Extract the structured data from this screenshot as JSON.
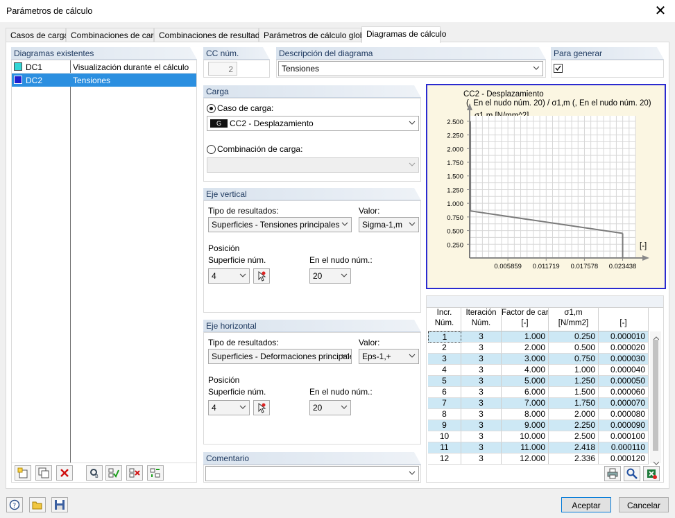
{
  "window": {
    "title": "Parámetros de cálculo",
    "close_glyph": "✕"
  },
  "tabs": [
    {
      "label": "Casos de carga"
    },
    {
      "label": "Combinaciones de carga"
    },
    {
      "label": "Combinaciones de resultados"
    },
    {
      "label": "Parámetros de cálculo global"
    },
    {
      "label": "Diagramas de cálculo",
      "active": true
    }
  ],
  "existing": {
    "header": "Diagramas existentes",
    "items": [
      {
        "id": "DC1",
        "desc": "Visualización durante el cálculo",
        "color": "#33d6d6",
        "selected": false
      },
      {
        "id": "DC2",
        "desc": "Tensiones",
        "color": "#1f1fd0",
        "selected": true
      }
    ]
  },
  "cc": {
    "header": "CC núm.",
    "value": "2"
  },
  "description": {
    "header": "Descripción del diagrama",
    "value": "Tensiones"
  },
  "generate": {
    "header": "Para generar",
    "checked": true
  },
  "carga": {
    "header": "Carga",
    "load_case_label": "Caso de carga:",
    "load_case_value": "CC2 - Desplazamiento",
    "load_case_tag": "G",
    "load_combo_label": "Combinación de carga:"
  },
  "vertical": {
    "header": "Eje vertical",
    "type_label": "Tipo de resultados:",
    "type_value": "Superficies - Tensiones principales",
    "value_label": "Valor:",
    "value_value": "Sigma-1,m",
    "position_label": "Posición",
    "surface_label": "Superficie núm.",
    "surface_value": "4",
    "node_label": "En el nudo núm.:",
    "node_value": "20"
  },
  "horizontal": {
    "header": "Eje horizontal",
    "type_label": "Tipo de resultados:",
    "type_value": "Superficies - Deformaciones principales",
    "value_label": "Valor:",
    "value_value": "Eps-1,+",
    "position_label": "Posición",
    "surface_label": "Superficie núm.",
    "surface_value": "4",
    "node_label": "En el nudo núm.:",
    "node_value": "20"
  },
  "comment": {
    "header": "Comentario",
    "value": ""
  },
  "chart_data": {
    "type": "line",
    "title_line1": "CC2 - Desplazamiento",
    "title_line2": "(, En el nudo núm. 20) / σ1,m (, En el nudo núm. 20)",
    "ylabel": "σ1,m [N/mm^2]",
    "xlabel": "[-]",
    "y_ticks": [
      "2.500",
      "2.250",
      "2.000",
      "1.750",
      "1.500",
      "1.250",
      "1.000",
      "0.750",
      "0.500",
      "0.250"
    ],
    "x_ticks": [
      "0.005859",
      "0.011719",
      "0.017578",
      "0.023438"
    ],
    "ylim": [
      0,
      2.6
    ],
    "xlim": [
      0,
      0.0254
    ],
    "grid": true,
    "series": [
      {
        "x": [
          0.0,
          1e-05,
          2e-05,
          3e-05,
          4e-05,
          5e-05,
          6e-05,
          7e-05,
          8e-05,
          9e-05,
          0.0001,
          0.00011,
          0.00012,
          0.023438
        ],
        "y": [
          0.0,
          0.25,
          0.5,
          0.75,
          1.0,
          1.25,
          1.5,
          1.75,
          2.0,
          2.25,
          2.5,
          2.418,
          0.86,
          0.45
        ]
      }
    ]
  },
  "table": {
    "headers": [
      {
        "l1": "Incr.",
        "l2": "Núm."
      },
      {
        "l1": "Iteración",
        "l2": "Núm."
      },
      {
        "l1": "Factor de car",
        "l2": "[-]"
      },
      {
        "l1": "σ1,m",
        "l2": "[N/mm2]"
      },
      {
        "l1": "",
        "l2": "[-]"
      }
    ],
    "rows": [
      [
        "1",
        "3",
        "1.000",
        "0.250",
        "0.000010"
      ],
      [
        "2",
        "3",
        "2.000",
        "0.500",
        "0.000020"
      ],
      [
        "3",
        "3",
        "3.000",
        "0.750",
        "0.000030"
      ],
      [
        "4",
        "3",
        "4.000",
        "1.000",
        "0.000040"
      ],
      [
        "5",
        "3",
        "5.000",
        "1.250",
        "0.000050"
      ],
      [
        "6",
        "3",
        "6.000",
        "1.500",
        "0.000060"
      ],
      [
        "7",
        "3",
        "7.000",
        "1.750",
        "0.000070"
      ],
      [
        "8",
        "3",
        "8.000",
        "2.000",
        "0.000080"
      ],
      [
        "9",
        "3",
        "9.000",
        "2.250",
        "0.000090"
      ],
      [
        "10",
        "3",
        "10.000",
        "2.500",
        "0.000100"
      ],
      [
        "11",
        "3",
        "11.000",
        "2.418",
        "0.000110"
      ],
      [
        "12",
        "3",
        "12.000",
        "2.336",
        "0.000120"
      ]
    ]
  },
  "footer": {
    "ok_label": "Aceptar",
    "cancel_label": "Cancelar"
  },
  "colors": {
    "accent_row": "#cde8f5",
    "selection": "#2b8fe0",
    "chart_border": "#2a2ad0",
    "chart_bg": "#fbf6e2"
  }
}
